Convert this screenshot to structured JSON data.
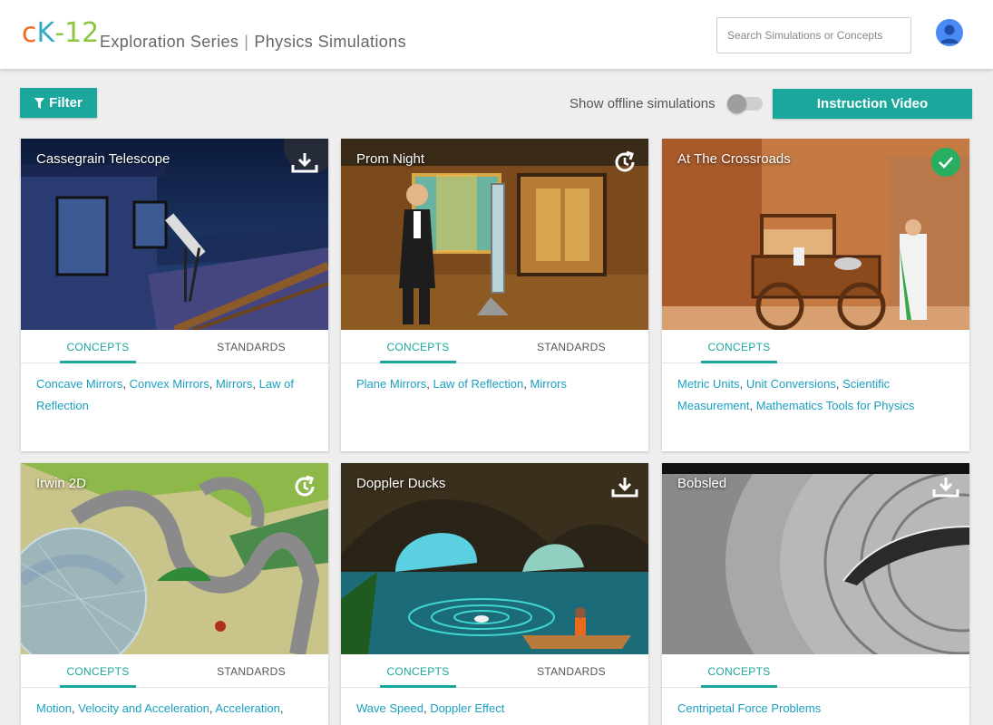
{
  "header": {
    "logo": {
      "c": "c",
      "k": "K",
      "dash": "-",
      "num": "12"
    },
    "series": "Exploration Series",
    "separator": "|",
    "subtitle": "Physics Simulations",
    "search_placeholder": "Search Simulations or Concepts"
  },
  "toolbar": {
    "filter_label": "Filter",
    "offline_label": "Show offline simulations",
    "offline_enabled": false,
    "video_label": "Instruction Video"
  },
  "tabs": {
    "concepts": "CONCEPTS",
    "standards": "STANDARDS"
  },
  "cards": [
    {
      "title": "Cassegrain Telescope",
      "status_icon": "download-icon",
      "has_standards": true,
      "concepts": [
        "Concave Mirrors",
        "Convex Mirrors",
        "Mirrors",
        "Law of Reflection"
      ]
    },
    {
      "title": "Prom Night",
      "status_icon": "update-icon",
      "has_standards": true,
      "concepts": [
        "Plane Mirrors",
        "Law of Reflection",
        "Mirrors"
      ]
    },
    {
      "title": "At The Crossroads",
      "status_icon": "check-icon",
      "has_standards": false,
      "concepts": [
        "Metric Units",
        "Unit Conversions",
        "Scientific Measurement",
        "Mathematics Tools for Physics"
      ]
    },
    {
      "title": "Irwin 2D",
      "status_icon": "update-icon",
      "has_standards": true,
      "concepts": [
        "Motion",
        "Velocity and Acceleration",
        "Acceleration"
      ]
    },
    {
      "title": "Doppler Ducks",
      "status_icon": "download-icon",
      "has_standards": true,
      "concepts": [
        "Wave Speed",
        "Doppler Effect"
      ]
    },
    {
      "title": "Bobsled",
      "status_icon": "download-icon",
      "has_standards": false,
      "concepts": [
        "Centripetal Force Problems"
      ]
    }
  ],
  "colors": {
    "accent": "#1ba79c",
    "link": "#1a9fc0",
    "check": "#27ae60"
  }
}
